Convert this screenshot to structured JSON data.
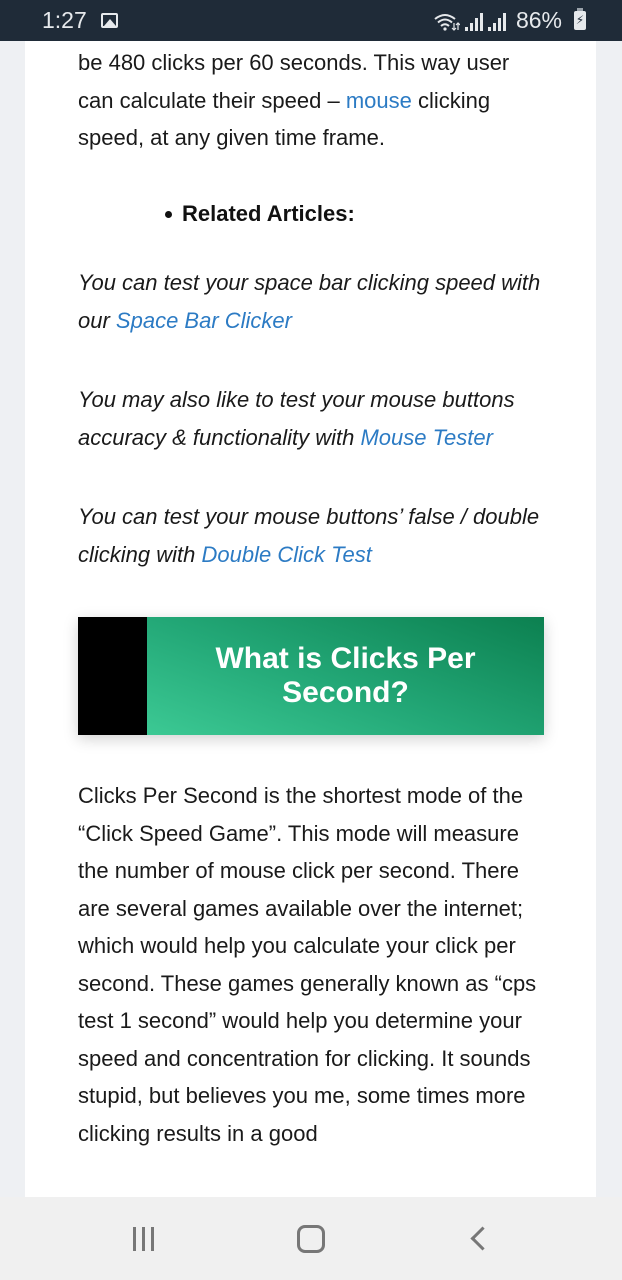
{
  "status_bar": {
    "time": "1:27",
    "battery": "86%",
    "icons": [
      "gallery-icon",
      "wifi-icon",
      "signal-icon",
      "signal-icon",
      "battery-charging-icon"
    ]
  },
  "article": {
    "intro": {
      "before": "be 480 clicks per 60 seconds. This way user can calculate their speed – ",
      "link": "mouse",
      "after": " clicking speed, at any given time frame."
    },
    "related_heading": "Related Articles:",
    "related": [
      {
        "before": "You can test your space bar clicking speed with our ",
        "link": "Space Bar Clicker"
      },
      {
        "before": "You may also like to test your mouse buttons accuracy & functionality with ",
        "link": "Mouse Tester"
      },
      {
        "before": "You can test your mouse buttons’ false / double clicking with ",
        "link": "Double Click Test"
      }
    ],
    "section_heading": "What is Clicks Per Second?",
    "body": "Clicks Per Second is the shortest mode of the “Click Speed Game”. This mode will measure the number of mouse click per second. There are several games available over the internet; which would help you calculate your click per second. These games generally known as “cps test 1 second” would help you determine your speed and concentration for clicking. It sounds stupid, but believes you me, some times more clicking results in a good"
  },
  "colors": {
    "link": "#2c7bc4",
    "heading_green": "#23a877",
    "status_bar": "#1f2b38"
  },
  "nav_bar": {
    "buttons": [
      "recent-apps",
      "home",
      "back"
    ]
  }
}
